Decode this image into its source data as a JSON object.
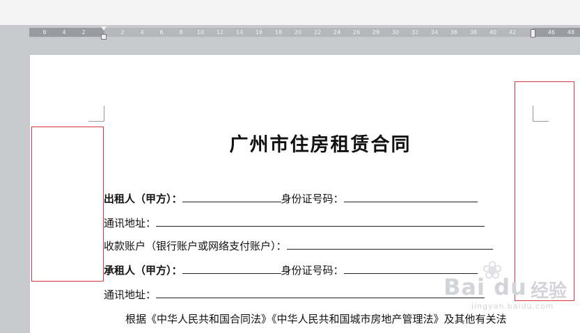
{
  "ruler": {
    "ticks": [
      "6",
      "4",
      "2",
      "2",
      "4",
      "6",
      "8",
      "10",
      "12",
      "14",
      "16",
      "18",
      "20",
      "22",
      "24",
      "26",
      "28",
      "30",
      "32",
      "34",
      "36",
      "38",
      "40",
      "42",
      "46",
      "48"
    ]
  },
  "document": {
    "title": "广州市住房租赁合同",
    "lines": [
      {
        "label": "出租人（甲方）：",
        "suffix_label": "身份证号码："
      },
      {
        "label": "通讯地址："
      },
      {
        "label": "收款账户（银行账户或网络支付账户）："
      },
      {
        "label": "承租人（甲方）：",
        "suffix_label": "身份证号码："
      },
      {
        "label": "通讯地址："
      }
    ],
    "paragraph": "根据《中华人民共和国合同法》《中华人民共和国城市房地产管理法》及其他有关法"
  },
  "watermark": {
    "brand": "Bai du",
    "product": "经验",
    "url": "jingyan.baidu.com"
  },
  "colors": {
    "highlight_box": "#d9363e",
    "workspace": "#c8c9cd",
    "ruler": "#9a9ba0"
  }
}
